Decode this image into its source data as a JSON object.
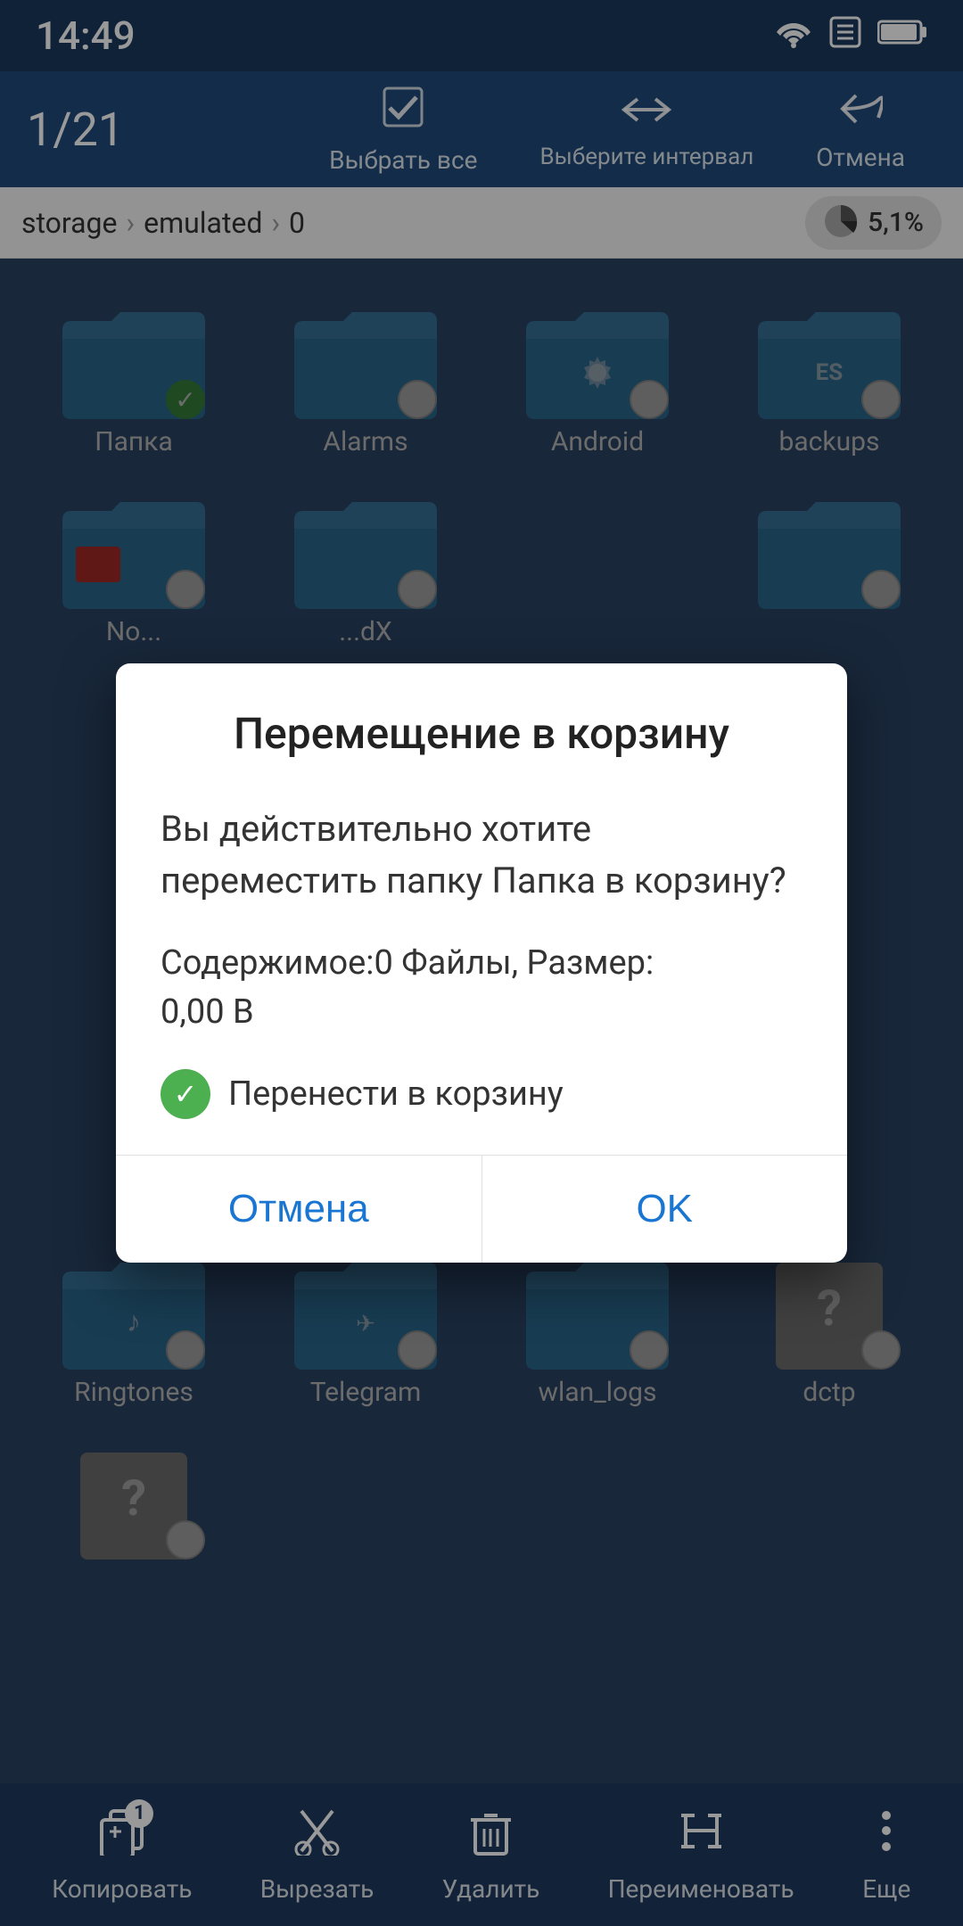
{
  "statusBar": {
    "time": "14:49",
    "wifiIcon": "wifi",
    "closeIcon": "⊠",
    "batteryIcon": "battery"
  },
  "toolbar": {
    "count": "1/21",
    "selectAllLabel": "Выбрать все",
    "selectIntervalLabel": "Выберите интервал",
    "cancelLabel": "Отмена"
  },
  "breadcrumb": {
    "items": [
      "storage",
      "emulated",
      "0"
    ],
    "storagePercent": "5,1%"
  },
  "files": [
    {
      "name": "Папка",
      "type": "folder",
      "selected": true
    },
    {
      "name": "Alarms",
      "type": "folder",
      "selected": false
    },
    {
      "name": "Android",
      "type": "folder-gear",
      "selected": false
    },
    {
      "name": "backups",
      "type": "folder-es",
      "selected": false
    },
    {
      "name": "No...",
      "type": "folder",
      "selected": false
    },
    {
      "name": "..dX",
      "type": "folder",
      "selected": false
    },
    {
      "name": "Ringtones",
      "type": "folder-music",
      "selected": false
    },
    {
      "name": "Telegram",
      "type": "folder-telegram",
      "selected": false
    },
    {
      "name": "wlan_logs",
      "type": "folder",
      "selected": false
    },
    {
      "name": "dctp",
      "type": "file-unknown",
      "selected": false
    }
  ],
  "dialog": {
    "title": "Перемещение в корзину",
    "message": "Вы действительно хотите переместить папку Папка в корзину?",
    "infoLabel": "Содержимое:0 Файлы, Размер:\n0,00 В",
    "optionLabel": "Перенести в корзину",
    "cancelBtn": "Отмена",
    "okBtn": "OK"
  },
  "bottomBar": {
    "copyLabel": "Копировать",
    "cutLabel": "Вырезать",
    "deleteLabel": "Удалить",
    "renameLabel": "Переименовать",
    "moreLabel": "Еще",
    "copyBadge": "1"
  }
}
